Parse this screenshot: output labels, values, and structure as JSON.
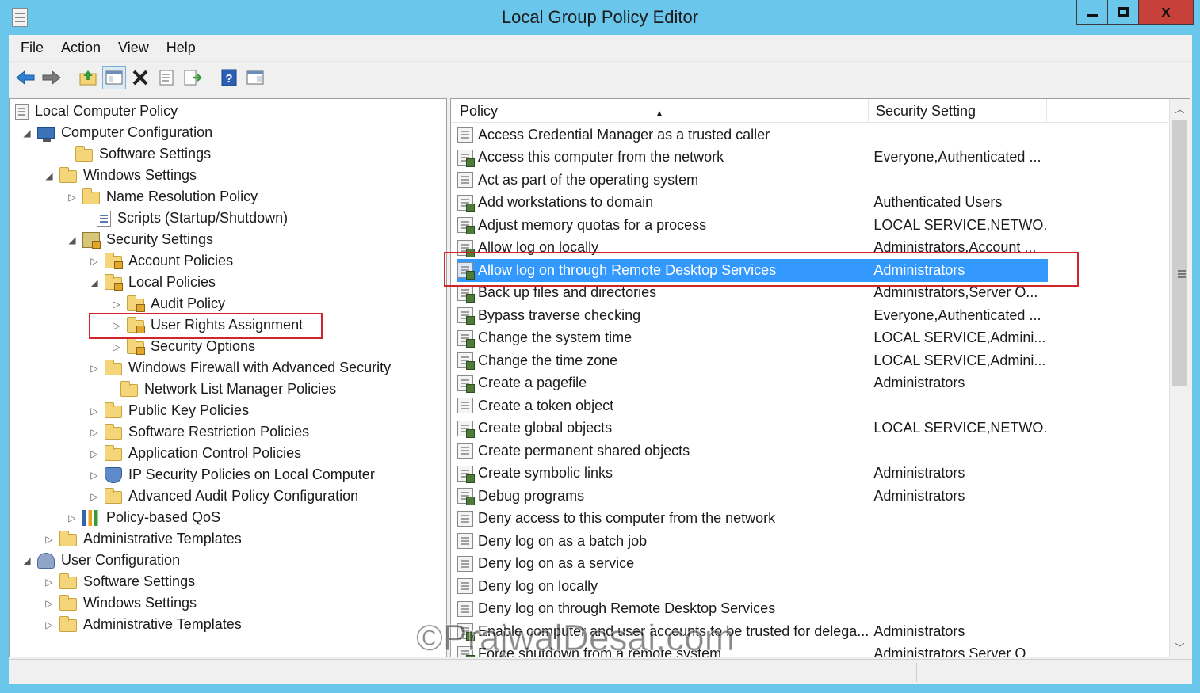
{
  "window": {
    "title": "Local Group Policy Editor",
    "close_label": "x"
  },
  "menu": [
    "File",
    "Action",
    "View",
    "Help"
  ],
  "toolbar_icons": [
    "back-arrow-icon",
    "forward-arrow-icon",
    "up-folder-icon",
    "show-hide-tree-icon",
    "delete-icon",
    "properties-icon",
    "export-list-icon",
    "help-icon",
    "show-hide-action-pane-icon"
  ],
  "tree": [
    {
      "label": "Local Computer Policy",
      "icon": "doc"
    },
    {
      "label": "Computer Configuration",
      "icon": "computer",
      "expander": "◢"
    },
    {
      "label": "Software Settings",
      "icon": "folder"
    },
    {
      "label": "Windows Settings",
      "icon": "folder",
      "expander": "◢"
    },
    {
      "label": "Name Resolution Policy",
      "icon": "folder",
      "expander": "▷"
    },
    {
      "label": "Scripts (Startup/Shutdown)",
      "icon": "scripts"
    },
    {
      "label": "Security Settings",
      "icon": "sec-settings",
      "expander": "◢"
    },
    {
      "label": "Account Policies",
      "icon": "folder lock",
      "expander": "▷"
    },
    {
      "label": "Local Policies",
      "icon": "folder lock",
      "expander": "◢"
    },
    {
      "label": "Audit Policy",
      "icon": "folder lock",
      "expander": "▷"
    },
    {
      "label": "User Rights Assignment",
      "icon": "folder lock",
      "expander": "▷"
    },
    {
      "label": "Security Options",
      "icon": "folder lock",
      "expander": "▷"
    },
    {
      "label": "Windows Firewall with Advanced Security",
      "icon": "folder",
      "expander": "▷"
    },
    {
      "label": "Network List Manager Policies",
      "icon": "folder"
    },
    {
      "label": "Public Key Policies",
      "icon": "folder",
      "expander": "▷"
    },
    {
      "label": "Software Restriction Policies",
      "icon": "folder",
      "expander": "▷"
    },
    {
      "label": "Application Control Policies",
      "icon": "folder",
      "expander": "▷"
    },
    {
      "label": "IP Security Policies on Local Computer",
      "icon": "shield",
      "expander": "▷"
    },
    {
      "label": "Advanced Audit Policy Configuration",
      "icon": "folder",
      "expander": "▷"
    },
    {
      "label": "Policy-based QoS",
      "icon": "chart",
      "expander": "▷"
    },
    {
      "label": "Administrative Templates",
      "icon": "folder",
      "expander": "▷"
    },
    {
      "label": "User Configuration",
      "icon": "users",
      "expander": "◢"
    },
    {
      "label": "Software Settings",
      "icon": "folder",
      "expander": "▷"
    },
    {
      "label": "Windows Settings",
      "icon": "folder",
      "expander": "▷"
    },
    {
      "label": "Administrative Templates",
      "icon": "folder",
      "expander": "▷"
    }
  ],
  "list": {
    "col_policy": "Policy",
    "col_setting": "Security Setting",
    "rows": [
      {
        "policy": "Access Credential Manager as a trusted caller",
        "setting": ""
      },
      {
        "policy": "Access this computer from the network",
        "setting": "Everyone,Authenticated ..."
      },
      {
        "policy": "Act as part of the operating system",
        "setting": ""
      },
      {
        "policy": "Add workstations to domain",
        "setting": "Authenticated Users"
      },
      {
        "policy": "Adjust memory quotas for a process",
        "setting": "LOCAL SERVICE,NETWO..."
      },
      {
        "policy": "Allow log on locally",
        "setting": "Administrators,Account ..."
      },
      {
        "policy": "Allow log on through Remote Desktop Services",
        "setting": "Administrators"
      },
      {
        "policy": "Back up files and directories",
        "setting": "Administrators,Server O..."
      },
      {
        "policy": "Bypass traverse checking",
        "setting": "Everyone,Authenticated ..."
      },
      {
        "policy": "Change the system time",
        "setting": "LOCAL SERVICE,Admini..."
      },
      {
        "policy": "Change the time zone",
        "setting": "LOCAL SERVICE,Admini..."
      },
      {
        "policy": "Create a pagefile",
        "setting": "Administrators"
      },
      {
        "policy": "Create a token object",
        "setting": ""
      },
      {
        "policy": "Create global objects",
        "setting": "LOCAL SERVICE,NETWO..."
      },
      {
        "policy": "Create permanent shared objects",
        "setting": ""
      },
      {
        "policy": "Create symbolic links",
        "setting": "Administrators"
      },
      {
        "policy": "Debug programs",
        "setting": "Administrators"
      },
      {
        "policy": "Deny access to this computer from the network",
        "setting": ""
      },
      {
        "policy": "Deny log on as a batch job",
        "setting": ""
      },
      {
        "policy": "Deny log on as a service",
        "setting": ""
      },
      {
        "policy": "Deny log on locally",
        "setting": ""
      },
      {
        "policy": "Deny log on through Remote Desktop Services",
        "setting": ""
      },
      {
        "policy": "Enable computer and user accounts to be trusted for delega...",
        "setting": "Administrators"
      },
      {
        "policy": "Force shutdown from a remote system",
        "setting": "Administrators,Server O..."
      }
    ]
  },
  "watermark": "©PrajwalDesai.com",
  "colors": {
    "selection": "#3399ff",
    "highlight_box": "#d3232b",
    "titlebar": "#6ac6ea"
  }
}
